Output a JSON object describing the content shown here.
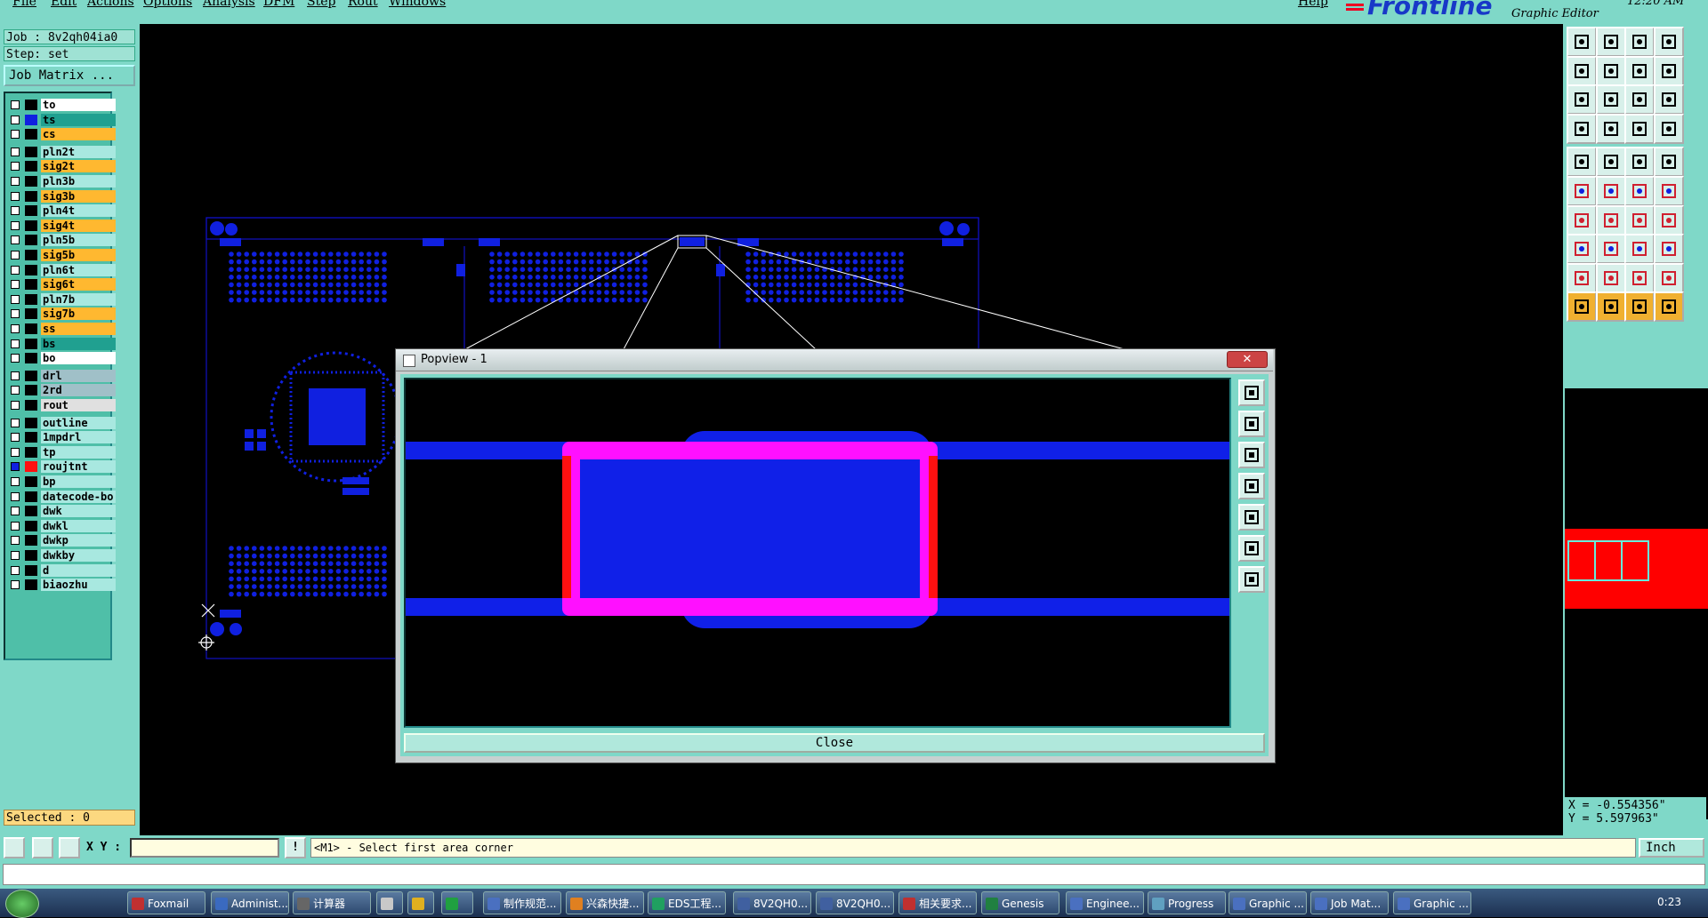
{
  "menu": [
    "File",
    "Edit",
    "Actions",
    "Options",
    "Analysis",
    "DFM",
    "Step",
    "Rout",
    "Windows"
  ],
  "help": "Help",
  "brand": {
    "logo": "Frontline",
    "subtitle": "Graphic Editor",
    "clock": "12:20 AM"
  },
  "job": {
    "job_label": "Job : 8v2qh04ia0",
    "step_label": "Step: set",
    "matrix_button": "Job Matrix ..."
  },
  "layers": [
    {
      "name": "to",
      "color": "#ffffff"
    },
    {
      "name": "ts",
      "color": "#20a090"
    },
    {
      "name": "cs",
      "color": "#ffb830"
    },
    {
      "name": "pln2t",
      "color": "#a8e8e0"
    },
    {
      "name": "sig2t",
      "color": "#ffb830"
    },
    {
      "name": "pln3b",
      "color": "#a8e8e0"
    },
    {
      "name": "sig3b",
      "color": "#ffb830"
    },
    {
      "name": "pln4t",
      "color": "#a8e8e0"
    },
    {
      "name": "sig4t",
      "color": "#ffb830"
    },
    {
      "name": "pln5b",
      "color": "#a8e8e0"
    },
    {
      "name": "sig5b",
      "color": "#ffb830"
    },
    {
      "name": "pln6t",
      "color": "#a8e8e0"
    },
    {
      "name": "sig6t",
      "color": "#ffb830"
    },
    {
      "name": "pln7b",
      "color": "#a8e8e0"
    },
    {
      "name": "sig7b",
      "color": "#ffb830"
    },
    {
      "name": "ss",
      "color": "#ffb830"
    },
    {
      "name": "bs",
      "color": "#20a090"
    },
    {
      "name": "bo",
      "color": "#ffffff"
    },
    {
      "name": "drl",
      "color": "#a0c0c8"
    },
    {
      "name": "2rd",
      "color": "#a0c0c8"
    },
    {
      "name": "rout",
      "color": "#e0e0e0"
    },
    {
      "name": "outline",
      "color": "#a8e8e0"
    },
    {
      "name": "1mpdrl",
      "color": "#a8e8e0"
    },
    {
      "name": "tp",
      "color": "#a8e8e0"
    },
    {
      "name": "roujtnt",
      "color": "#a8e8e0"
    },
    {
      "name": "bp",
      "color": "#a8e8e0"
    },
    {
      "name": "datecode-bo",
      "color": "#a8e8e0"
    },
    {
      "name": "dwk",
      "color": "#a8e8e0"
    },
    {
      "name": "dwkl",
      "color": "#a8e8e0"
    },
    {
      "name": "dwkp",
      "color": "#a8e8e0"
    },
    {
      "name": "dwkby",
      "color": "#a8e8e0"
    },
    {
      "name": "d",
      "color": "#a8e8e0"
    },
    {
      "name": "biaozhu",
      "color": "#a8e8e0"
    }
  ],
  "selected": "Selected : 0",
  "popview": {
    "title": "Popview - 1",
    "close_label": "Close"
  },
  "coords": {
    "x": "X = -0.554356\"",
    "y": "Y = 5.597963\""
  },
  "command": {
    "xy_label": "X Y :",
    "xy_value": "",
    "prompt": "<M1> - Select first area corner",
    "units": "Inch"
  },
  "taskbar": {
    "items": [
      "Foxmail",
      "Administ...",
      "计算器",
      "",
      "",
      "",
      "制作规范...",
      "兴森快捷...",
      "EDS工程...",
      "8V2QH0...",
      "8V2QH0...",
      "相关要求...",
      "Genesis",
      "Enginee...",
      "Progress",
      "Graphic ...",
      "Job Mat...",
      "Graphic ..."
    ],
    "clock": "0:23"
  }
}
